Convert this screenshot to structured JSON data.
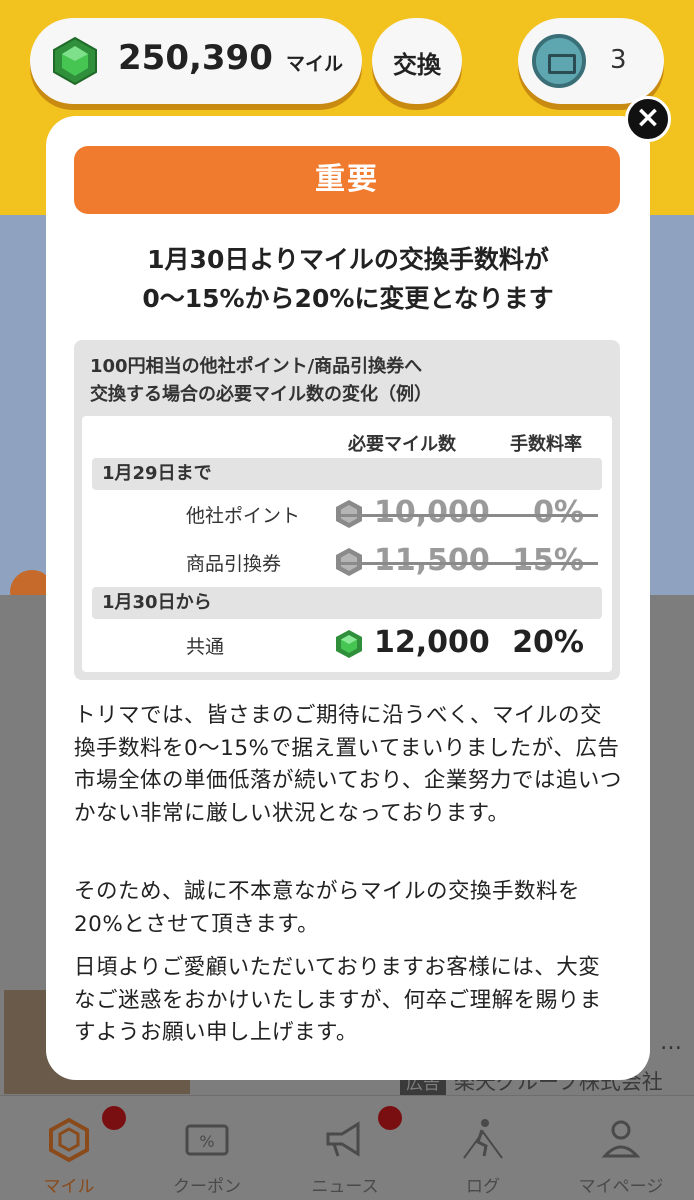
{
  "header": {
    "miles_value": "250,390",
    "miles_unit": "マイル",
    "exchange_label": "交換",
    "ticket_count": "3"
  },
  "modal": {
    "banner": "重要",
    "headline_line1": "1月30日よりマイルの交換手数料が",
    "headline_line2": "0〜15%から20%に変更となります",
    "table": {
      "caption_line1": "100円相当の他社ポイント/商品引換券へ",
      "caption_line2": "交換する場合の必要マイル数の変化（例）",
      "col_miles": "必要マイル数",
      "col_rate": "手数料率",
      "section_before": "1月29日まで",
      "section_after": "1月30日から",
      "rows": [
        {
          "label": "他社ポイント",
          "miles": "10,000",
          "rate": "0%"
        },
        {
          "label": "商品引換券",
          "miles": "11,500",
          "rate": "15%"
        },
        {
          "label": "共通",
          "miles": "12,000",
          "rate": "20%"
        }
      ]
    },
    "paragraph1": "トリマでは、皆さまのご期待に沿うべく、マイルの交換手数料を0〜15%で据え置いてまいりましたが、広告市場全体の単価低落が続いており、企業努力では追いつかない非常に厳しい状況となっております。",
    "paragraph2": "そのため、誠に不本意ながらマイルの交換手数料を20%とさせて頂きます。",
    "paragraph3": "日頃よりご愛顧いただいておりますお客様には、大変なご迷惑をおかけいたしますが、何卒ご理解を賜りますようお願い申し上げます。"
  },
  "background": {
    "ad_badge": "広告",
    "ad_company": "楽天グループ株式会社",
    "ad_more": "…"
  },
  "nav": {
    "items": [
      {
        "label": "マイル",
        "icon": "miles-icon"
      },
      {
        "label": "クーポン",
        "icon": "coupon-icon"
      },
      {
        "label": "ニュース",
        "icon": "news-icon"
      },
      {
        "label": "ログ",
        "icon": "log-icon"
      },
      {
        "label": "マイページ",
        "icon": "mypage-icon"
      }
    ]
  },
  "colors": {
    "accent_orange": "#f07a2e",
    "header_yellow": "#f2c21e",
    "gem_green": "#3bb54a",
    "notification_red": "#d0141a"
  }
}
